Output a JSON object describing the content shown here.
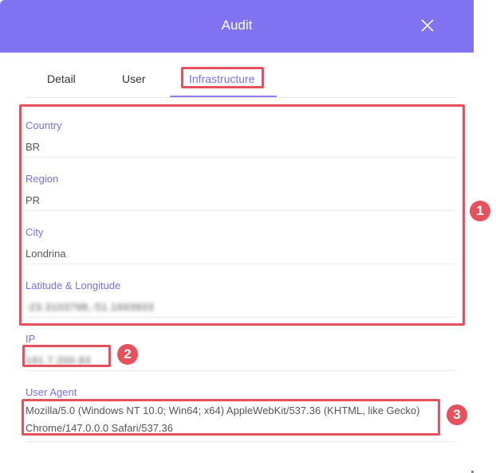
{
  "dialog": {
    "title": "Audit",
    "close_icon": "close-icon"
  },
  "tabs": [
    {
      "label": "Detail",
      "active": false
    },
    {
      "label": "User",
      "active": false
    },
    {
      "label": "Infrastructure",
      "active": true
    }
  ],
  "fields": {
    "country": {
      "label": "Country",
      "value": "BR"
    },
    "region": {
      "label": "Region",
      "value": "PR"
    },
    "city": {
      "label": "City",
      "value": "Londrina"
    },
    "latlng": {
      "label": "Latitude & Longitude",
      "value": "-23.3103798,-51.1693933"
    },
    "ip": {
      "label": "IP",
      "value": "191.7.200.83"
    },
    "user_agent": {
      "label": "User Agent",
      "value": "Mozilla/5.0 (Windows NT 10.0; Win64; x64) AppleWebKit/537.36 (KHTML, like Gecko) Chrome/147.0.0.0 Safari/537.36"
    }
  },
  "annotations": {
    "badge1": "1",
    "badge2": "2",
    "badge3": "3",
    "color": "#e8505b"
  },
  "colors": {
    "header": "#8072f0",
    "accent": "#7b6ee8"
  }
}
